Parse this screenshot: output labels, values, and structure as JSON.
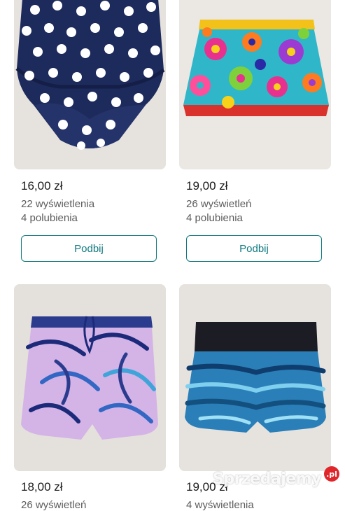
{
  "listings": [
    {
      "price": "16,00 zł",
      "views": "22 wyświetlenia",
      "likes": "4 polubienia",
      "button": "Podbij",
      "photo_subject": "navy-polka-dot-swim-bottoms"
    },
    {
      "price": "19,00 zł",
      "views": "26 wyświetleń",
      "likes": "4 polubienia",
      "button": "Podbij",
      "photo_subject": "floral-ruffled-swim-skirt"
    },
    {
      "price": "18,00 zł",
      "views": "26 wyświetleń",
      "likes": "",
      "button": "",
      "photo_subject": "tropical-leaf-print-shorts"
    },
    {
      "price": "19,00 zł",
      "views": "4 wyświetlenia",
      "likes": "",
      "button": "",
      "photo_subject": "blue-print-sport-shorts"
    }
  ],
  "watermark": {
    "text": "Sprzedajemy",
    "badge": ".pl"
  },
  "colors": {
    "accent": "#117a80",
    "price_text": "#1a1a1a",
    "meta_text": "#5c5c5c",
    "watermark_badge": "#e0262b"
  }
}
